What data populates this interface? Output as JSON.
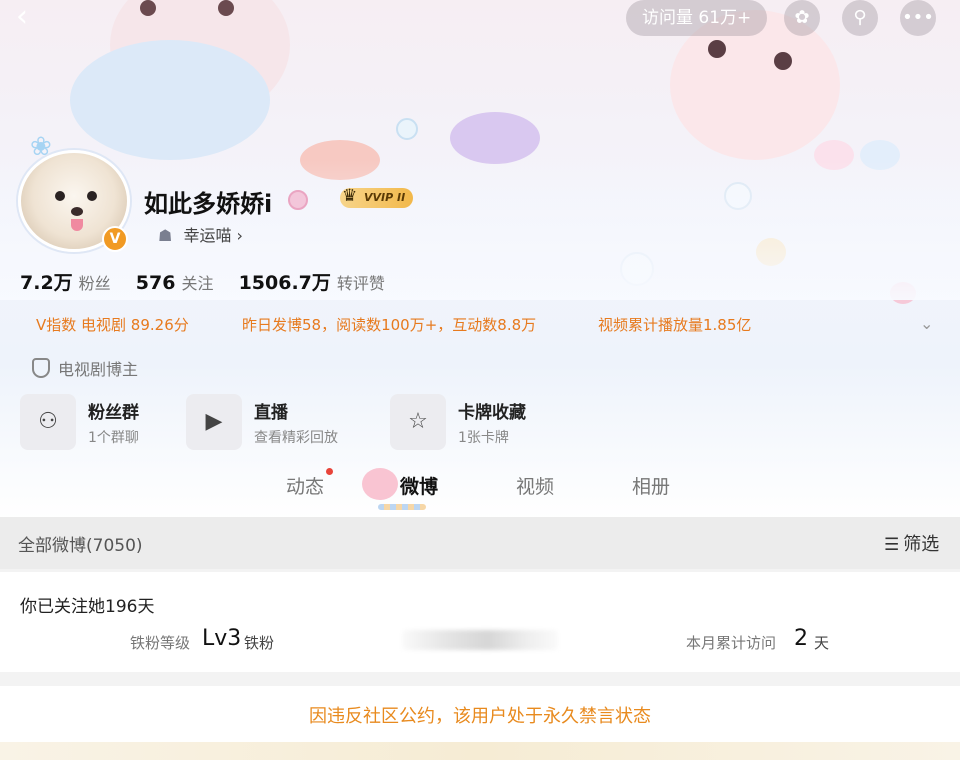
{
  "topbar": {
    "back_icon": "back-arrow-icon",
    "visits": "访问量 61万+",
    "buttons": [
      "rabbit-icon",
      "search-icon",
      "more-icon"
    ]
  },
  "profile": {
    "name": "如此多娇娇i",
    "vip_badge": "VVIP II",
    "sub_tag": "幸运喵",
    "sub_tag_arrow": "›",
    "verified_badge": "V"
  },
  "stats": [
    {
      "value": "7.2万",
      "label": "粉丝"
    },
    {
      "value": "576",
      "label": "关注"
    },
    {
      "value": "1506.7万",
      "label": "转评赞"
    }
  ],
  "info_line": {
    "v_index": "V指数 电视剧 89.26分",
    "yesterday": "昨日发博58，阅读数100万+，互动数8.8万",
    "video": "视频累计播放量1.85亿"
  },
  "blogger_tag": "电视剧博主",
  "quick_entries": [
    {
      "icon": "fan-group-icon",
      "title": "粉丝群",
      "desc": "1个群聊"
    },
    {
      "icon": "live-tv-icon",
      "title": "直播",
      "desc": "查看精彩回放"
    },
    {
      "icon": "card-collection-icon",
      "title": "卡牌收藏",
      "desc": "1张卡牌"
    }
  ],
  "tabs": [
    {
      "label": "动态",
      "active": false
    },
    {
      "label": "微博",
      "active": true
    },
    {
      "label": "视频",
      "active": false
    },
    {
      "label": "相册",
      "active": false
    }
  ],
  "feed_header": {
    "all_label": "全部微博(7050)",
    "filter_label": "筛选"
  },
  "fan_card": {
    "followed_days": "你已关注她196天",
    "level_label": "铁粉等级",
    "level_value": "Lv3",
    "level_sub": "铁粉",
    "visit_label": "本月累计访问",
    "visit_value": "2",
    "visit_unit": "天"
  },
  "ban_notice": "因违反社区公约，该用户处于永久禁言状态",
  "colors": {
    "accent_orange": "#e77a1e",
    "vip_gold": "#f2b84a",
    "notice_orange": "#e88a1e"
  }
}
